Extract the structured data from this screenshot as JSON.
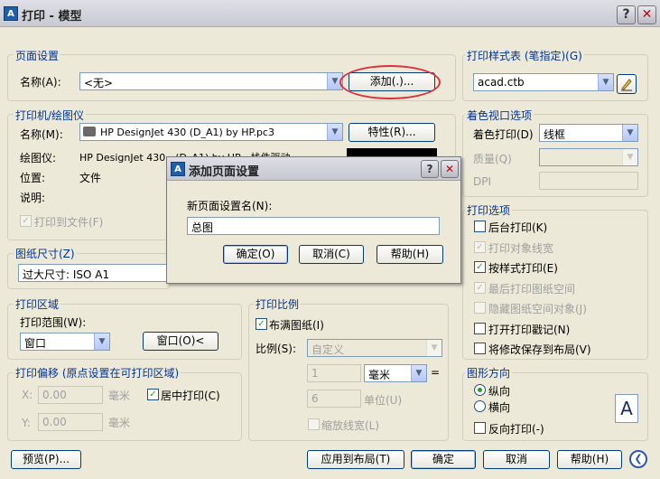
{
  "window": {
    "title": "打印 - 模型",
    "app_icon": "autocad-icon",
    "help_glyph": "?",
    "close_glyph": "✕"
  },
  "page_setup": {
    "group_label": "页面设置",
    "name_label": "名称(A):",
    "name_value": "<无>",
    "add_button": "添加(.)..."
  },
  "printer": {
    "group_label": "打印机/绘图仪",
    "name_label": "名称(M):",
    "name_value": "HP DesignJet 430 (D_A1) by HP.pc3",
    "properties_button": "特性(R)...",
    "plotter_label": "绘图仪:",
    "plotter_value": "HP DesignJet 430 - (D_A1) by HP - 栈件驱动",
    "location_label": "位置:",
    "location_value": "文件",
    "description_label": "说明:",
    "print_to_file": "打印到文件(F)"
  },
  "paper_size": {
    "group_label": "图纸尺寸(Z)",
    "value": "过大尺寸: ISO A1"
  },
  "plot_area": {
    "group_label": "打印区域",
    "range_label": "打印范围(W):",
    "range_value": "窗口",
    "window_button": "窗口(O)<"
  },
  "plot_offset": {
    "group_label": "打印偏移 (原点设置在可打印区域)",
    "x_label": "X:",
    "x_value": "0.00",
    "x_unit": "毫米",
    "y_label": "Y:",
    "y_value": "0.00",
    "y_unit": "毫米",
    "center_label": "居中打印(C)"
  },
  "plot_scale": {
    "group_label": "打印比例",
    "fit_label": "布满图纸(I)",
    "scale_label": "比例(S):",
    "scale_value": "自定义",
    "num_value": "1",
    "unit_value": "毫米",
    "equals": "=",
    "den_value": "6",
    "den_unit": "单位(U)",
    "scale_lineweights": "缩放线宽(L)"
  },
  "plot_style": {
    "group_label": "打印样式表 (笔指定)(G)",
    "value": "acad.ctb"
  },
  "shaded": {
    "group_label": "着色视口选项",
    "shade_label": "着色打印(D)",
    "shade_value": "线框",
    "quality_label": "质量(Q)",
    "dpi_label": "DPI"
  },
  "options": {
    "group_label": "打印选项",
    "items": [
      {
        "label": "后台打印(K)",
        "checked": false,
        "enabled": true
      },
      {
        "label": "打印对象线宽",
        "checked": true,
        "enabled": false
      },
      {
        "label": "按样式打印(E)",
        "checked": true,
        "enabled": true
      },
      {
        "label": "最后打印图纸空间",
        "checked": true,
        "enabled": false
      },
      {
        "label": "隐藏图纸空间对象(J)",
        "checked": false,
        "enabled": false
      },
      {
        "label": "打开打印戳记(N)",
        "checked": false,
        "enabled": true
      },
      {
        "label": "将修改保存到布局(V)",
        "checked": false,
        "enabled": true
      }
    ]
  },
  "orientation": {
    "group_label": "图形方向",
    "portrait": "纵向",
    "landscape": "横向",
    "reverse": "反向打印(-)",
    "preview_glyph": "A"
  },
  "footer": {
    "preview": "预览(P)...",
    "apply": "应用到布局(T)",
    "ok": "确定",
    "cancel": "取消",
    "help": "帮助(H)",
    "expand_glyph": "❮"
  },
  "dialog": {
    "title": "添加页面设置",
    "help_glyph": "?",
    "close_glyph": "✕",
    "prompt": "新页面设置名(N):",
    "input_value": "总图",
    "ok": "确定(O)",
    "cancel": "取消(C)",
    "help": "帮助(H)"
  }
}
